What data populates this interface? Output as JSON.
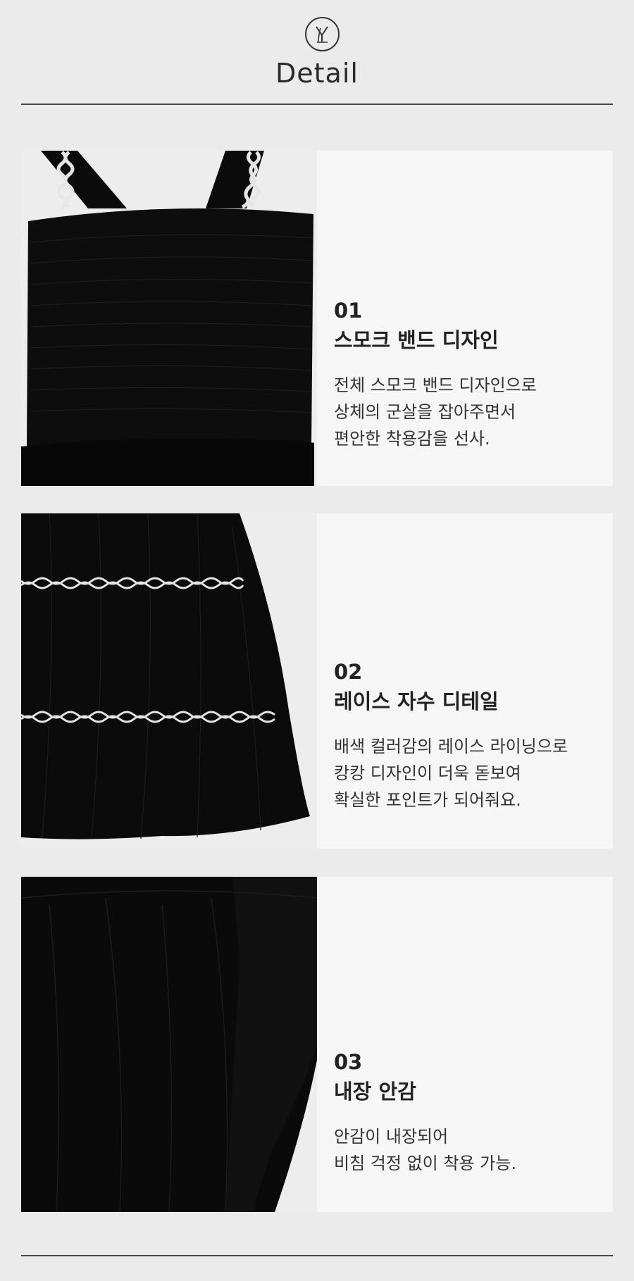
{
  "header": {
    "logo_text": "YL",
    "title": "Detail"
  },
  "sections": [
    {
      "number": "01",
      "title": "스모크 밴드 디자인",
      "lines": [
        "전체 스모크 밴드 디자인으로",
        "상체의 군살을 잡아주면서",
        "편안한 착용감을 선사."
      ],
      "photo_icon": "smocked-bodice-photo"
    },
    {
      "number": "02",
      "title": "레이스 자수 디테일",
      "lines": [
        "배색 컬러감의 레이스 라이닝으로",
        "캉캉 디자인이 더욱 돋보여",
        "확실한 포인트가 되어줘요."
      ],
      "photo_icon": "lace-skirt-photo"
    },
    {
      "number": "03",
      "title": "내장 안감",
      "lines": [
        "안감이 내장되어",
        "비침 걱정 없이 착용 가능."
      ],
      "photo_icon": "lining-photo"
    }
  ],
  "colors": {
    "background": "#ebebeb",
    "panel": "#f6f6f6",
    "dress": "#0b0b0b",
    "lace": "#e6e6e6"
  }
}
